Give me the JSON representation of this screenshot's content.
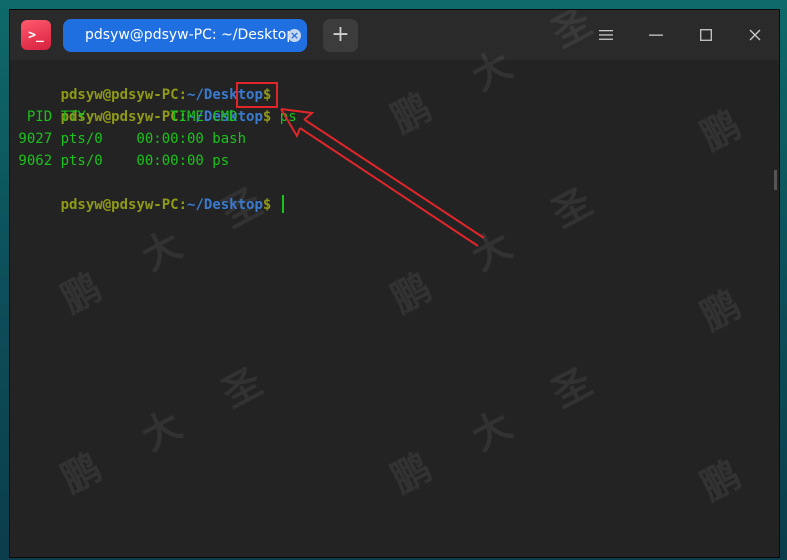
{
  "titlebar": {
    "tab_title": "pdsyw@pdsyw-PC: ~/Desktop",
    "tab_close": "×",
    "add_tab": "+",
    "app_icon_text": ">_"
  },
  "terminal": {
    "prompt_user": "pdsyw@pdsyw-PC",
    "prompt_colon": ":",
    "prompt_path": "~/Desktop",
    "prompt_dollar": "$",
    "command": "ps",
    "output_lines": [
      "  PID TTY          TIME CMD",
      " 9027 pts/0    00:00:00 bash",
      " 9062 pts/0    00:00:00 ps"
    ]
  },
  "watermark": {
    "char1": "鹏",
    "char2": "大",
    "char3": "圣"
  },
  "colors": {
    "accent_tab": "#1f6fe0",
    "annotation_red": "#e0262a",
    "prompt_user": "#8f9a18",
    "prompt_path": "#3a7bd0",
    "output_green": "#1cc21c"
  },
  "icons": {
    "app": "terminal-app-icon",
    "menu": "hamburger-menu-icon",
    "minimize": "minimize-icon",
    "maximize": "maximize-icon",
    "close": "close-icon",
    "annotation": "red-arrow-annotation"
  }
}
